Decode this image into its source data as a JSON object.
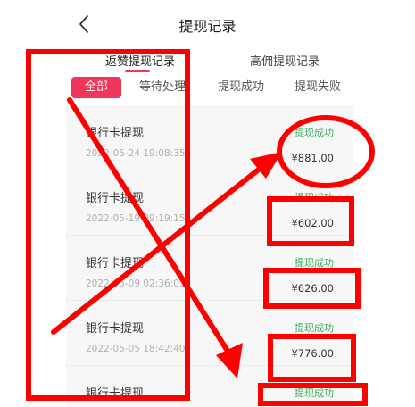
{
  "header": {
    "title": "提现记录",
    "back_icon": "chevron-left-icon"
  },
  "tabs": [
    {
      "label": "返赞提现记录",
      "active": true
    },
    {
      "label": "高佣提现记录",
      "active": false
    }
  ],
  "filters": [
    {
      "label": "全部",
      "active": true
    },
    {
      "label": "等待处理",
      "active": false
    },
    {
      "label": "提现成功",
      "active": false
    },
    {
      "label": "提现失败",
      "active": false
    }
  ],
  "records": [
    {
      "name": "银行卡提现",
      "time": "2022-05-24 19:08:35",
      "status": "提现成功",
      "amount": "¥881.00"
    },
    {
      "name": "银行卡提现",
      "time": "2022-05-19 09:19:15",
      "status": "提现成功",
      "amount": "¥602.00"
    },
    {
      "name": "银行卡提现",
      "time": "2022-05-09 02:36:01",
      "status": "提现成功",
      "amount": "¥626.00"
    },
    {
      "name": "银行卡提现",
      "time": "2022-05-05 18:42:40",
      "status": "提现成功",
      "amount": "¥776.00"
    },
    {
      "name": "银行卡提现",
      "time": "",
      "status": "提现成功",
      "amount": ""
    }
  ],
  "colors": {
    "accent": "#f2355b",
    "success": "#3cab62",
    "annotation": "#ff0000"
  }
}
